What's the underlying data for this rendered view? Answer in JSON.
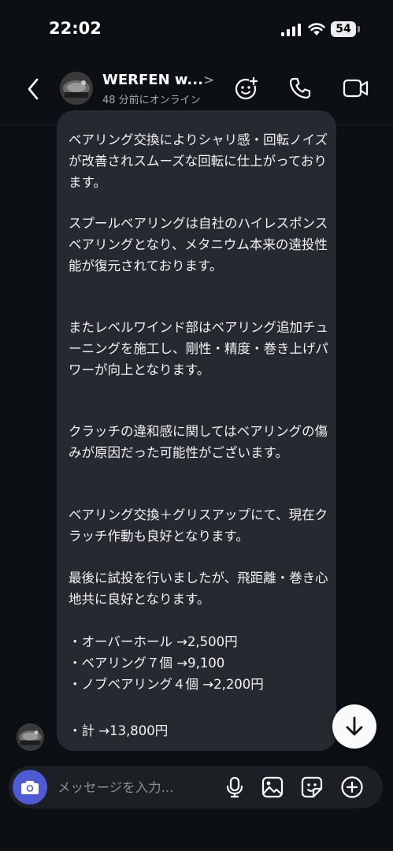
{
  "status_bar": {
    "time": "22:02",
    "battery": "54"
  },
  "header": {
    "name": "WERFEN w...",
    "chevron": ">",
    "status": "48 分前にオンライン"
  },
  "message": {
    "paragraphs": [
      "ベアリング交換によりシャリ感・回転ノイズが改善されスムーズな回転に仕上がっております。",
      "スプールベアリングは自社のハイレスポンスベアリングとなり、メタニウム本来の遠投性能が復元されております。",
      "またレベルワインド部はベアリング追加チューニングを施工し、剛性・精度・巻き上げパワーが向上となります。",
      "クラッチの違和感に関してはベアリングの傷みが原因だった可能性がございます。",
      "ベアリング交換＋グリスアップにて、現在クラッチ作動も良好となります。",
      "最後に試投を行いましたが、飛距離・巻き心地共に良好となります。",
      "・オーバーホール →2,500円\n・ベアリング７個 →9,100\n・ノブベアリング４個 →2,200円",
      "・計 →13,800円"
    ]
  },
  "composer": {
    "placeholder": "メッセージを入力..."
  },
  "colors": {
    "background": "#0c1014",
    "bubble": "#262a30",
    "camera_accent": "#4f5bd5"
  }
}
